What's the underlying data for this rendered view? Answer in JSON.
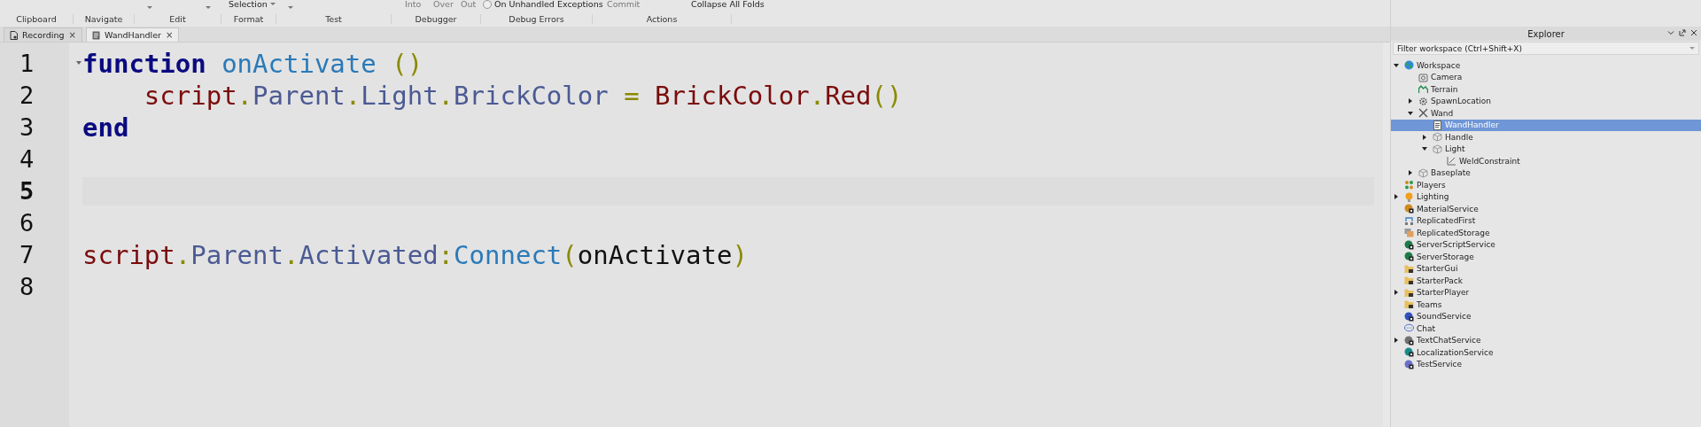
{
  "ribbon": {
    "top_items": [
      {
        "kind": "caret"
      },
      {
        "kind": "caret"
      },
      {
        "kind": "dropdown",
        "label": "Selection"
      },
      {
        "kind": "caret"
      },
      {
        "kind": "text",
        "label": "Into",
        "disabled": true
      },
      {
        "kind": "text",
        "label": "Over",
        "disabled": true
      },
      {
        "kind": "text",
        "label": "Out",
        "disabled": true
      },
      {
        "kind": "radio",
        "label": "On Unhandled Exceptions",
        "checked": false
      },
      {
        "kind": "text",
        "label": "Commit",
        "disabled": true
      },
      {
        "kind": "text",
        "label": "Collapse All Folds",
        "disabled": false
      }
    ],
    "groups": [
      "Clipboard",
      "Navigate",
      "Edit",
      "Format",
      "Test",
      "Debugger",
      "Debug Errors",
      "Actions"
    ]
  },
  "tabs": [
    {
      "label": "Recording",
      "kind": "recording",
      "selected": false,
      "close": "×"
    },
    {
      "label": "WandHandler",
      "kind": "script",
      "selected": true,
      "close": "×"
    }
  ],
  "editor": {
    "lines": [
      {
        "number": "1",
        "current": false,
        "foldable": true,
        "tokens": [
          {
            "text": "function",
            "kind": "keyword"
          },
          {
            "text": "onActivate",
            "kind": "method",
            "space_before": true
          },
          {
            "text": "()",
            "kind": "op",
            "space_before": true
          }
        ]
      },
      {
        "number": "2",
        "current": false,
        "indented": true,
        "tokens": [
          {
            "text": "script",
            "kind": "builtin"
          },
          {
            "text": ".",
            "kind": "op"
          },
          {
            "text": "Parent",
            "kind": "prop"
          },
          {
            "text": ".",
            "kind": "op"
          },
          {
            "text": "Light",
            "kind": "prop"
          },
          {
            "text": ".",
            "kind": "op"
          },
          {
            "text": "BrickColor",
            "kind": "prop"
          },
          {
            "text": " = ",
            "kind": "op"
          },
          {
            "text": "BrickColor",
            "kind": "builtin"
          },
          {
            "text": ".",
            "kind": "op"
          },
          {
            "text": "Red",
            "kind": "builtin"
          },
          {
            "text": "()",
            "kind": "op"
          }
        ]
      },
      {
        "number": "3",
        "current": false,
        "tokens": [
          {
            "text": "end",
            "kind": "keyword"
          }
        ]
      },
      {
        "number": "4",
        "current": false
      },
      {
        "number": "5",
        "current": true
      },
      {
        "number": "6",
        "current": false
      },
      {
        "number": "7",
        "current": false,
        "tokens": [
          {
            "text": "script",
            "kind": "builtin"
          },
          {
            "text": ".",
            "kind": "op"
          },
          {
            "text": "Parent",
            "kind": "prop"
          },
          {
            "text": ".",
            "kind": "op"
          },
          {
            "text": "Activated",
            "kind": "prop"
          },
          {
            "text": ":",
            "kind": "op"
          },
          {
            "text": "Connect",
            "kind": "method"
          },
          {
            "text": "(",
            "kind": "op"
          },
          {
            "text": "onActivate",
            "kind": "plain"
          },
          {
            "text": ")",
            "kind": "op"
          }
        ]
      },
      {
        "number": "8",
        "current": false
      }
    ]
  },
  "explorer": {
    "title": "Explorer",
    "filter": {
      "placeholder": "Filter workspace (Ctrl+Shift+X)"
    },
    "tree": [
      {
        "label": "Workspace",
        "kind": "globe",
        "selected": false,
        "expanded": true,
        "children": [
          {
            "label": "Camera",
            "kind": "camera",
            "selected": false
          },
          {
            "label": "Terrain",
            "kind": "terrain",
            "selected": false
          },
          {
            "label": "SpawnLocation",
            "kind": "gear",
            "selected": false,
            "expanded": false
          },
          {
            "label": "Wand",
            "kind": "tool",
            "selected": false,
            "expanded": true,
            "children": [
              {
                "label": "WandHandler",
                "kind": "script",
                "selected": true
              },
              {
                "label": "Handle",
                "kind": "part",
                "selected": false,
                "expanded": false
              },
              {
                "label": "Light",
                "kind": "part",
                "selected": false,
                "expanded": true,
                "children": [
                  {
                    "label": "WeldConstraint",
                    "kind": "weld",
                    "selected": false
                  }
                ]
              }
            ]
          },
          {
            "label": "Baseplate",
            "kind": "part",
            "selected": false,
            "expanded": false
          }
        ]
      },
      {
        "label": "Players",
        "kind": "players",
        "selected": false
      },
      {
        "label": "Lighting",
        "kind": "bulb",
        "selected": false,
        "expanded": false
      },
      {
        "label": "MaterialService",
        "kind": "service",
        "color": "#d08a20",
        "selected": false
      },
      {
        "label": "ReplicatedFirst",
        "kind": "replicated",
        "selected": false
      },
      {
        "label": "ReplicatedStorage",
        "kind": "storage",
        "selected": false
      },
      {
        "label": "ServerScriptService",
        "kind": "service",
        "color": "#1f7a4a",
        "selected": false
      },
      {
        "label": "ServerStorage",
        "kind": "service",
        "color": "#1f7a4a",
        "selected": false
      },
      {
        "label": "StarterGui",
        "kind": "folder",
        "selected": false
      },
      {
        "label": "StarterPack",
        "kind": "folder",
        "selected": false
      },
      {
        "label": "StarterPlayer",
        "kind": "folder",
        "selected": false,
        "expanded": false
      },
      {
        "label": "Teams",
        "kind": "folder",
        "selected": false
      },
      {
        "label": "SoundService",
        "kind": "service",
        "color": "#3050c0",
        "selected": false
      },
      {
        "label": "Chat",
        "kind": "chat",
        "selected": false
      },
      {
        "label": "TextChatService",
        "kind": "service",
        "color": "#707070",
        "selected": false,
        "expanded": false
      },
      {
        "label": "LocalizationService",
        "kind": "service",
        "color": "#1a8a8a",
        "selected": false
      },
      {
        "label": "TestService",
        "kind": "service",
        "color": "#6a70c8",
        "selected": false
      }
    ]
  }
}
